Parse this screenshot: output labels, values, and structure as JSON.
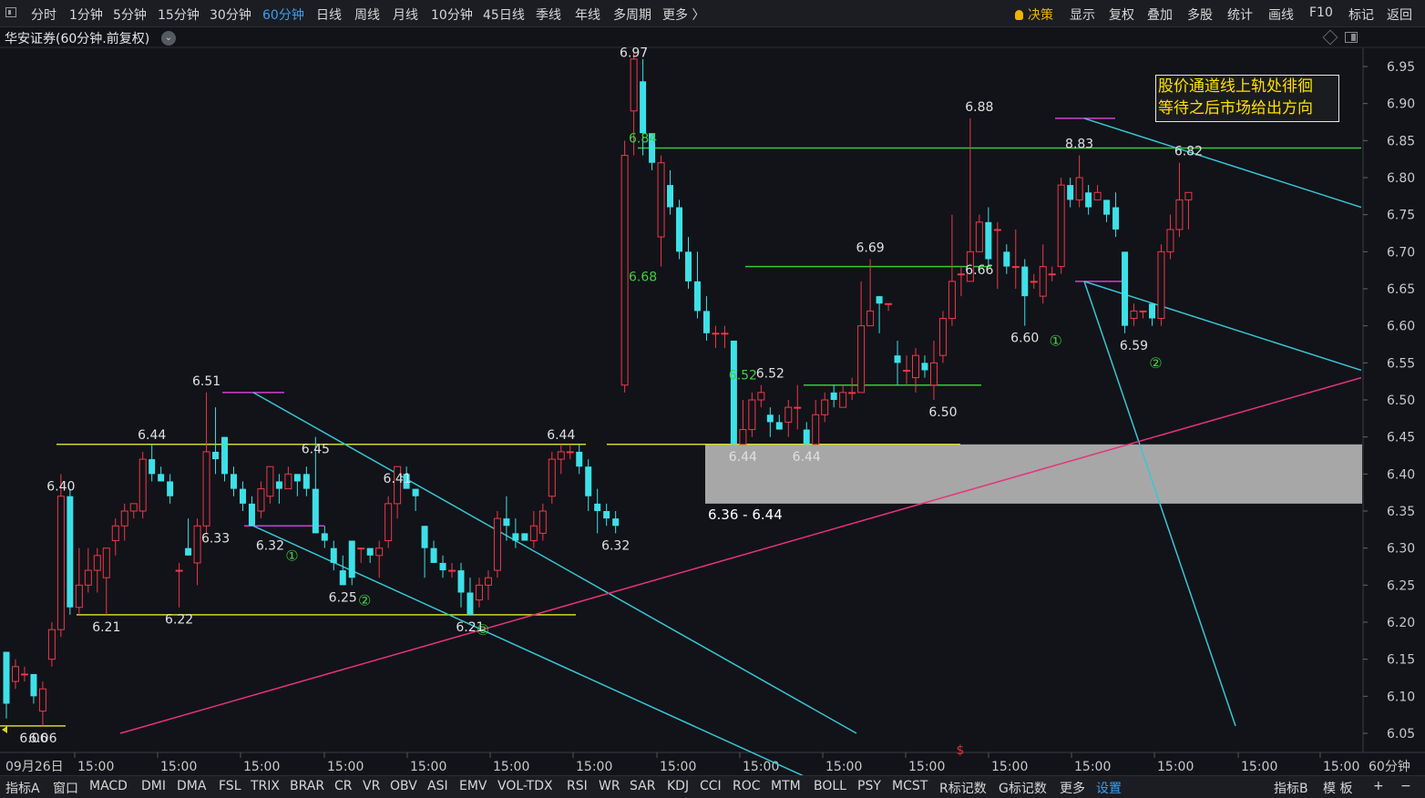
{
  "top_bar": {
    "periods": [
      "分时",
      "1分钟",
      "5分钟",
      "15分钟",
      "30分钟",
      "60分钟",
      "日线",
      "周线",
      "月线",
      "10分钟",
      "45日线",
      "季线",
      "年线",
      "多周期",
      "更多 〉"
    ],
    "active_period": "60分钟",
    "right_tools": [
      "决策",
      "显示",
      "复权",
      "叠加",
      "多股",
      "统计",
      "画线",
      "F10",
      "标记",
      "返回"
    ]
  },
  "chart_title": "华安证券(60分钟.前复权)",
  "annotation": {
    "line1": "股价通道线上轨处徘徊",
    "line2": "等待之后市场给出方向"
  },
  "colors": {
    "up": "#f0374a",
    "down": "#3ee0e8",
    "support_line": "#d6d626",
    "channel_line": "#39c5d6",
    "trend_line": "#e8327a",
    "level_line": "#38c838",
    "marker_line": "#d040d0",
    "zone_fill": "#c8c8c8"
  },
  "chart_data": {
    "type": "candlestick",
    "y_axis_ticks": [
      "6.95",
      "6.90",
      "6.85",
      "6.80",
      "6.75",
      "6.70",
      "6.65",
      "6.60",
      "6.55",
      "6.50",
      "6.45",
      "6.40",
      "6.35",
      "6.30",
      "6.25",
      "6.20",
      "6.15",
      "6.10",
      "6.05"
    ],
    "x_axis_labels": [
      "09月26日",
      "15:00",
      "15:00",
      "15:00",
      "15:00",
      "15:00",
      "15:00",
      "15:00",
      "15:00",
      "15:00",
      "15:00",
      "15:00",
      "15:00",
      "15:00",
      "15:00",
      "15:00",
      "15:00"
    ],
    "period_label": "60分钟",
    "candles": [
      [
        6.16,
        6.09,
        6.07,
        6.16
      ],
      [
        6.12,
        6.14,
        6.11,
        6.15
      ],
      [
        6.13,
        6.13,
        6.12,
        6.14
      ],
      [
        6.13,
        6.1,
        6.09,
        6.13
      ],
      [
        6.08,
        6.11,
        6.06,
        6.12
      ],
      [
        6.15,
        6.19,
        6.14,
        6.2
      ],
      [
        6.19,
        6.37,
        6.18,
        6.4
      ],
      [
        6.37,
        6.22,
        6.21,
        6.38
      ],
      [
        6.22,
        6.25,
        6.21,
        6.3
      ],
      [
        6.25,
        6.27,
        6.24,
        6.3
      ],
      [
        6.27,
        6.29,
        6.24,
        6.3
      ],
      [
        6.26,
        6.3,
        6.21,
        6.3
      ],
      [
        6.31,
        6.33,
        6.29,
        6.34
      ],
      [
        6.33,
        6.35,
        6.31,
        6.36
      ],
      [
        6.35,
        6.36,
        6.34,
        6.36
      ],
      [
        6.35,
        6.42,
        6.34,
        6.43
      ],
      [
        6.42,
        6.4,
        6.39,
        6.44
      ],
      [
        6.4,
        6.39,
        6.39,
        6.41
      ],
      [
        6.39,
        6.37,
        6.36,
        6.4
      ],
      [
        6.27,
        6.27,
        6.22,
        6.28
      ],
      [
        6.3,
        6.29,
        6.29,
        6.34
      ],
      [
        6.28,
        6.33,
        6.25,
        6.34
      ],
      [
        6.33,
        6.43,
        6.32,
        6.51
      ],
      [
        6.43,
        6.42,
        6.4,
        6.49
      ],
      [
        6.45,
        6.4,
        6.39,
        6.45
      ],
      [
        6.4,
        6.38,
        6.37,
        6.41
      ],
      [
        6.38,
        6.36,
        6.35,
        6.39
      ],
      [
        6.36,
        6.33,
        6.33,
        6.37
      ],
      [
        6.35,
        6.38,
        6.34,
        6.39
      ],
      [
        6.37,
        6.41,
        6.36,
        6.41
      ],
      [
        6.39,
        6.38,
        6.36,
        6.4
      ],
      [
        6.38,
        6.4,
        6.38,
        6.41
      ],
      [
        6.4,
        6.39,
        6.37,
        6.4
      ],
      [
        6.4,
        6.38,
        6.37,
        6.41
      ],
      [
        6.38,
        6.32,
        6.32,
        6.45
      ],
      [
        6.32,
        6.31,
        6.3,
        6.33
      ],
      [
        6.3,
        6.28,
        6.27,
        6.31
      ],
      [
        6.27,
        6.25,
        6.25,
        6.29
      ],
      [
        6.31,
        6.26,
        6.25,
        6.31
      ],
      [
        6.3,
        6.3,
        6.28,
        6.3
      ],
      [
        6.3,
        6.29,
        6.28,
        6.3
      ],
      [
        6.29,
        6.3,
        6.26,
        6.31
      ],
      [
        6.31,
        6.36,
        6.3,
        6.37
      ],
      [
        6.36,
        6.41,
        6.34,
        6.41
      ],
      [
        6.4,
        6.38,
        6.38,
        6.41
      ],
      [
        6.38,
        6.37,
        6.35,
        6.38
      ],
      [
        6.33,
        6.3,
        6.26,
        6.33
      ],
      [
        6.3,
        6.28,
        6.28,
        6.31
      ],
      [
        6.28,
        6.27,
        6.26,
        6.29
      ],
      [
        6.27,
        6.27,
        6.26,
        6.28
      ],
      [
        6.27,
        6.24,
        6.22,
        6.28
      ],
      [
        6.24,
        6.21,
        6.21,
        6.26
      ],
      [
        6.23,
        6.25,
        6.22,
        6.26
      ],
      [
        6.25,
        6.26,
        6.23,
        6.27
      ],
      [
        6.27,
        6.34,
        6.26,
        6.35
      ],
      [
        6.34,
        6.33,
        6.31,
        6.37
      ],
      [
        6.32,
        6.31,
        6.3,
        6.34
      ],
      [
        6.32,
        6.31,
        6.31,
        6.32
      ],
      [
        6.31,
        6.33,
        6.3,
        6.35
      ],
      [
        6.32,
        6.35,
        6.31,
        6.36
      ],
      [
        6.37,
        6.42,
        6.36,
        6.43
      ],
      [
        6.42,
        6.43,
        6.4,
        6.44
      ],
      [
        6.43,
        6.43,
        6.42,
        6.44
      ],
      [
        6.43,
        6.41,
        6.4,
        6.44
      ],
      [
        6.41,
        6.37,
        6.35,
        6.42
      ],
      [
        6.36,
        6.35,
        6.32,
        6.38
      ],
      [
        6.35,
        6.34,
        6.33,
        6.36
      ],
      [
        6.34,
        6.33,
        6.32,
        6.35
      ],
      [
        6.52,
        6.83,
        6.51,
        6.85
      ],
      [
        6.89,
        6.96,
        6.83,
        6.97
      ],
      [
        6.93,
        6.86,
        6.83,
        6.96
      ],
      [
        6.86,
        6.82,
        6.81,
        6.84
      ],
      [
        6.72,
        6.82,
        6.68,
        6.83
      ],
      [
        6.79,
        6.76,
        6.75,
        6.81
      ],
      [
        6.76,
        6.7,
        6.69,
        6.77
      ],
      [
        6.7,
        6.66,
        6.65,
        6.72
      ],
      [
        6.66,
        6.62,
        6.61,
        6.7
      ],
      [
        6.62,
        6.59,
        6.58,
        6.64
      ],
      [
        6.59,
        6.59,
        6.57,
        6.6
      ],
      [
        6.59,
        6.59,
        6.57,
        6.6
      ],
      [
        6.58,
        6.44,
        6.44,
        6.58
      ],
      [
        6.44,
        6.46,
        6.44,
        6.5
      ],
      [
        6.46,
        6.5,
        6.45,
        6.51
      ],
      [
        6.5,
        6.51,
        6.49,
        6.52
      ],
      [
        6.48,
        6.47,
        6.45,
        6.49
      ],
      [
        6.47,
        6.46,
        6.46,
        6.48
      ],
      [
        6.47,
        6.49,
        6.45,
        6.5
      ],
      [
        6.49,
        6.49,
        6.46,
        6.52
      ],
      [
        6.46,
        6.44,
        6.44,
        6.47
      ],
      [
        6.44,
        6.48,
        6.44,
        6.5
      ],
      [
        6.48,
        6.5,
        6.47,
        6.51
      ],
      [
        6.51,
        6.5,
        6.49,
        6.52
      ],
      [
        6.49,
        6.51,
        6.49,
        6.52
      ],
      [
        6.51,
        6.51,
        6.5,
        6.53
      ],
      [
        6.51,
        6.6,
        6.51,
        6.66
      ],
      [
        6.6,
        6.62,
        6.6,
        6.69
      ],
      [
        6.64,
        6.63,
        6.59,
        6.64
      ],
      [
        6.63,
        6.63,
        6.62,
        6.63
      ],
      [
        6.56,
        6.55,
        6.52,
        6.58
      ],
      [
        6.54,
        6.54,
        6.52,
        6.56
      ],
      [
        6.53,
        6.56,
        6.51,
        6.57
      ],
      [
        6.55,
        6.54,
        6.53,
        6.56
      ],
      [
        6.52,
        6.55,
        6.5,
        6.58
      ],
      [
        6.56,
        6.61,
        6.55,
        6.62
      ],
      [
        6.61,
        6.66,
        6.6,
        6.75
      ],
      [
        6.67,
        6.67,
        6.64,
        6.68
      ],
      [
        6.66,
        6.7,
        6.66,
        6.88
      ],
      [
        6.7,
        6.74,
        6.7,
        6.75
      ],
      [
        6.74,
        6.69,
        6.68,
        6.76
      ],
      [
        6.73,
        6.73,
        6.65,
        6.74
      ],
      [
        6.7,
        6.68,
        6.67,
        6.71
      ],
      [
        6.68,
        6.68,
        6.65,
        6.73
      ],
      [
        6.68,
        6.64,
        6.6,
        6.69
      ],
      [
        6.66,
        6.66,
        6.65,
        6.67
      ],
      [
        6.64,
        6.68,
        6.63,
        6.71
      ],
      [
        6.67,
        6.67,
        6.66,
        6.68
      ],
      [
        6.68,
        6.79,
        6.67,
        6.8
      ],
      [
        6.79,
        6.77,
        6.76,
        6.8
      ],
      [
        6.77,
        6.8,
        6.76,
        6.83
      ],
      [
        6.78,
        6.76,
        6.75,
        6.79
      ],
      [
        6.77,
        6.78,
        6.77,
        6.79
      ],
      [
        6.77,
        6.75,
        6.74,
        6.77
      ],
      [
        6.76,
        6.73,
        6.72,
        6.78
      ],
      [
        6.7,
        6.6,
        6.59,
        6.7
      ],
      [
        6.61,
        6.62,
        6.6,
        6.63
      ],
      [
        6.62,
        6.62,
        6.61,
        6.62
      ],
      [
        6.63,
        6.61,
        6.6,
        6.63
      ],
      [
        6.61,
        6.7,
        6.6,
        6.71
      ],
      [
        6.7,
        6.73,
        6.69,
        6.75
      ],
      [
        6.73,
        6.77,
        6.72,
        6.82
      ],
      [
        6.77,
        6.78,
        6.73,
        6.78
      ]
    ],
    "price_labels": [
      {
        "label": "6.97",
        "i": 69,
        "price": 6.97
      },
      {
        "label": "6.84",
        "i": 70,
        "price": 6.84,
        "color": "green"
      },
      {
        "label": "6.68",
        "i": 70,
        "price": 6.68,
        "color": "green"
      },
      {
        "label": "6.69",
        "i": 95,
        "price": 6.69
      },
      {
        "label": "6.52",
        "i": 81,
        "price": 6.52,
        "color": "green"
      },
      {
        "label": "6.52",
        "i": 84,
        "price": 6.52
      },
      {
        "label": "6.44",
        "i": 81,
        "price": 6.44
      },
      {
        "label": "6.44",
        "i": 88,
        "price": 6.44
      },
      {
        "label": "6.50",
        "i": 103,
        "price": 6.5
      },
      {
        "label": "6.88",
        "i": 107,
        "price": 6.88
      },
      {
        "label": "6.66",
        "i": 107,
        "price": 6.66
      },
      {
        "label": "6.60",
        "i": 112,
        "price": 6.6
      },
      {
        "label": "8.83",
        "i": 118,
        "price": 6.83
      },
      {
        "label": "6.59",
        "i": 124,
        "price": 6.59
      },
      {
        "label": "6.82",
        "i": 130,
        "price": 6.82
      },
      {
        "label": "6.51",
        "i": 22,
        "price": 6.51
      },
      {
        "label": "6.44",
        "i": 16,
        "price": 6.44
      },
      {
        "label": "6.40",
        "i": 6,
        "price": 6.4
      },
      {
        "label": "6.45",
        "i": 34,
        "price": 6.45
      },
      {
        "label": "6.41",
        "i": 43,
        "price": 6.41
      },
      {
        "label": "6.33",
        "i": 23,
        "price": 6.33
      },
      {
        "label": "6.32",
        "i": 29,
        "price": 6.32
      },
      {
        "label": "6.25",
        "i": 37,
        "price": 6.25
      },
      {
        "label": "6.22",
        "i": 19,
        "price": 6.22
      },
      {
        "label": "6.21",
        "i": 11,
        "price": 6.21
      },
      {
        "label": "6.21",
        "i": 51,
        "price": 6.21
      },
      {
        "label": "6.44",
        "i": 61,
        "price": 6.44
      },
      {
        "label": "6.32",
        "i": 67,
        "price": 6.32
      },
      {
        "label": "6.06",
        "i": 4,
        "price": 6.06
      },
      {
        "label": "6.06",
        "i": 3,
        "price": 6.06
      }
    ],
    "circle_markers": [
      {
        "label": "①",
        "i": 31,
        "price": 6.31
      },
      {
        "label": "②",
        "i": 39,
        "price": 6.25
      },
      {
        "label": "③",
        "i": 52,
        "price": 6.21
      },
      {
        "label": "①",
        "i": 115,
        "price": 6.6
      },
      {
        "label": "②",
        "i": 126,
        "price": 6.57
      }
    ],
    "zone": {
      "low": 6.36,
      "high": 6.44,
      "label": "6.36 - 6.44"
    },
    "cursor_marker": "$"
  },
  "bottom_bar": {
    "tabs": [
      "指标A",
      "窗口",
      "MACD",
      "DMI",
      "DMA",
      "FSL",
      "TRIX",
      "BRAR",
      "CR",
      "VR",
      "OBV",
      "ASI",
      "EMV",
      "VOL-TDX",
      "RSI",
      "WR",
      "SAR",
      "KDJ",
      "CCI",
      "ROC",
      "MTM",
      "BOLL",
      "PSY",
      "MCST",
      "R标记数",
      "G标记数",
      "更多",
      "设置"
    ],
    "active_tab": "设置",
    "right_tabs": [
      "指标B",
      "模 板",
      "+",
      "−"
    ]
  }
}
